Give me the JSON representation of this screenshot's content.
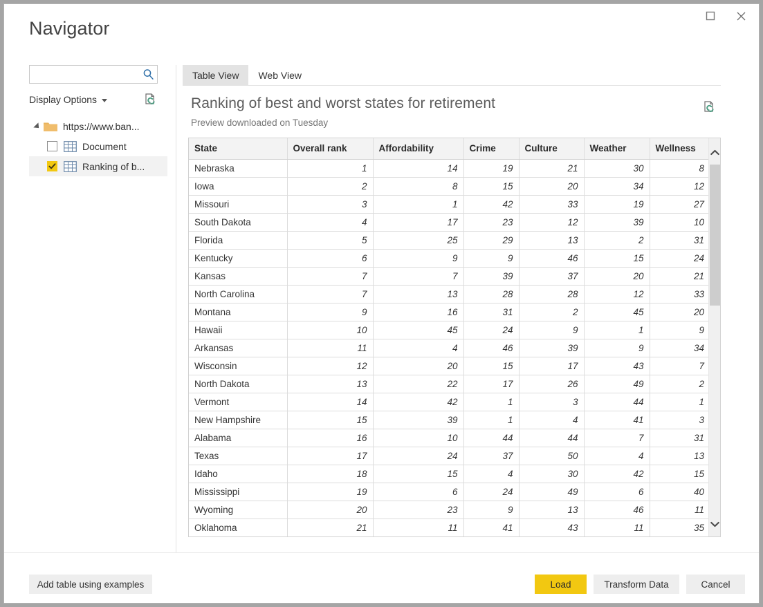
{
  "window": {
    "title": "Navigator",
    "controls": [
      {
        "name": "maximize",
        "label": "Maximize"
      },
      {
        "name": "close",
        "label": "Close"
      }
    ]
  },
  "nav": {
    "search": {
      "value": "",
      "placeholder": ""
    },
    "display_options_label": "Display Options",
    "refresh_icon": "refresh-document-icon",
    "tree": [
      {
        "label": "https://www.ban...",
        "type": "folder",
        "expanded": true,
        "indent": 0,
        "checkbox": null,
        "selected": false
      },
      {
        "label": "Document",
        "type": "table",
        "indent": 1,
        "checkbox": "unchecked",
        "selected": false
      },
      {
        "label": "Ranking of b...",
        "type": "table",
        "indent": 1,
        "checkbox": "checked",
        "selected": true
      }
    ]
  },
  "preview": {
    "tabs": [
      {
        "label": "Table View",
        "active": true
      },
      {
        "label": "Web View",
        "active": false
      }
    ],
    "title": "Ranking of best and worst states for retirement",
    "subtitle": "Preview downloaded on Tuesday",
    "refresh_icon": "refresh-document-icon",
    "scrollbar": {
      "up_icon": "chevron-up-icon",
      "down_icon": "chevron-down-icon"
    }
  },
  "table": {
    "columns": [
      "State",
      "Overall rank",
      "Affordability",
      "Crime",
      "Culture",
      "Weather",
      "Wellness"
    ],
    "rows": [
      [
        "Nebraska",
        "1",
        "14",
        "19",
        "21",
        "30",
        "8"
      ],
      [
        "Iowa",
        "2",
        "8",
        "15",
        "20",
        "34",
        "12"
      ],
      [
        "Missouri",
        "3",
        "1",
        "42",
        "33",
        "19",
        "27"
      ],
      [
        "South Dakota",
        "4",
        "17",
        "23",
        "12",
        "39",
        "10"
      ],
      [
        "Florida",
        "5",
        "25",
        "29",
        "13",
        "2",
        "31"
      ],
      [
        "Kentucky",
        "6",
        "9",
        "9",
        "46",
        "15",
        "24"
      ],
      [
        "Kansas",
        "7",
        "7",
        "39",
        "37",
        "20",
        "21"
      ],
      [
        "North Carolina",
        "7",
        "13",
        "28",
        "28",
        "12",
        "33"
      ],
      [
        "Montana",
        "9",
        "16",
        "31",
        "2",
        "45",
        "20"
      ],
      [
        "Hawaii",
        "10",
        "45",
        "24",
        "9",
        "1",
        "9"
      ],
      [
        "Arkansas",
        "11",
        "4",
        "46",
        "39",
        "9",
        "34"
      ],
      [
        "Wisconsin",
        "12",
        "20",
        "15",
        "17",
        "43",
        "7"
      ],
      [
        "North Dakota",
        "13",
        "22",
        "17",
        "26",
        "49",
        "2"
      ],
      [
        "Vermont",
        "14",
        "42",
        "1",
        "3",
        "44",
        "1"
      ],
      [
        "New Hampshire",
        "15",
        "39",
        "1",
        "4",
        "41",
        "3"
      ],
      [
        "Alabama",
        "16",
        "10",
        "44",
        "44",
        "7",
        "31"
      ],
      [
        "Texas",
        "17",
        "24",
        "37",
        "50",
        "4",
        "13"
      ],
      [
        "Idaho",
        "18",
        "15",
        "4",
        "30",
        "42",
        "15"
      ],
      [
        "Mississippi",
        "19",
        "6",
        "24",
        "49",
        "6",
        "40"
      ],
      [
        "Wyoming",
        "20",
        "23",
        "9",
        "13",
        "46",
        "11"
      ],
      [
        "Oklahoma",
        "21",
        "11",
        "41",
        "43",
        "11",
        "35"
      ]
    ]
  },
  "footer": {
    "add_table_label": "Add table using examples",
    "load_label": "Load",
    "transform_label": "Transform Data",
    "cancel_label": "Cancel"
  },
  "colors": {
    "accent": "#f2c811",
    "window_bg": "#a5a5a5",
    "tab_active": "#e3e3e3",
    "header_bg": "#f3f3f3",
    "title_text": "#444444"
  }
}
